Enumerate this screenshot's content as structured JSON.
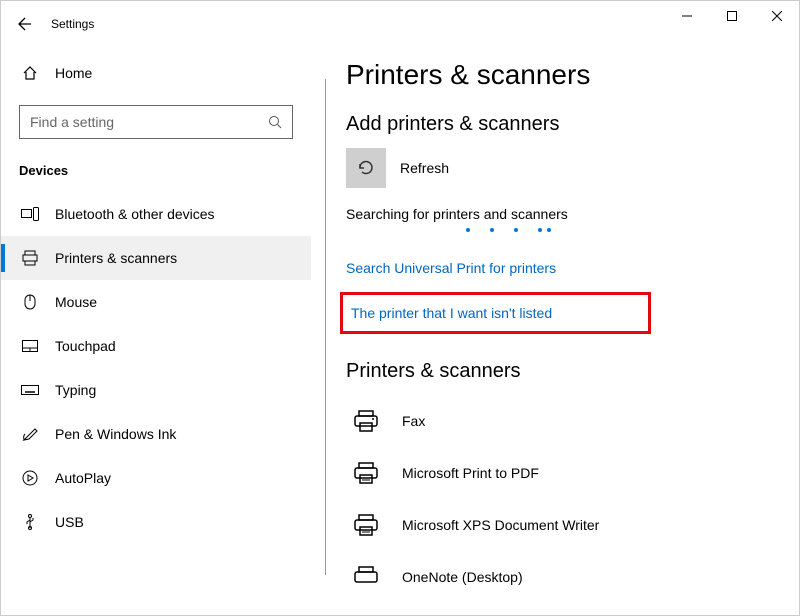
{
  "titlebar": {
    "app_name": "Settings"
  },
  "sidebar": {
    "home_label": "Home",
    "search_placeholder": "Find a setting",
    "section_title": "Devices",
    "items": [
      {
        "label": "Bluetooth & other devices"
      },
      {
        "label": "Printers & scanners"
      },
      {
        "label": "Mouse"
      },
      {
        "label": "Touchpad"
      },
      {
        "label": "Typing"
      },
      {
        "label": "Pen & Windows Ink"
      },
      {
        "label": "AutoPlay"
      },
      {
        "label": "USB"
      }
    ]
  },
  "main": {
    "heading": "Printers & scanners",
    "add_heading": "Add printers & scanners",
    "refresh_label": "Refresh",
    "searching_text": "Searching for printers and scanners",
    "link_universal": "Search Universal Print for printers",
    "link_notlisted": "The printer that I want isn't listed",
    "list_heading": "Printers & scanners",
    "devices": [
      {
        "label": "Fax"
      },
      {
        "label": "Microsoft Print to PDF"
      },
      {
        "label": "Microsoft XPS Document Writer"
      },
      {
        "label": "OneNote (Desktop)"
      }
    ]
  }
}
